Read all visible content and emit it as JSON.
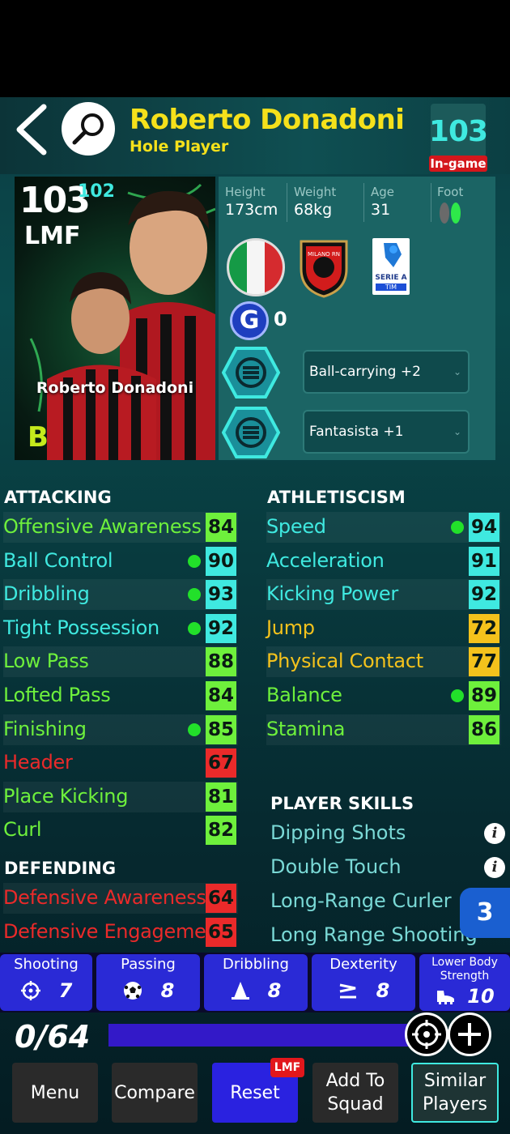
{
  "header": {
    "player_name": "Roberto Donadoni",
    "role": "Hole Player",
    "overall": "103",
    "overall_tag": "In-game"
  },
  "card": {
    "rating": "103",
    "sub_rating": "102",
    "position": "LMF",
    "name": "Roberto Donadoni",
    "grade": "B"
  },
  "info": {
    "height_label": "Height",
    "height": "173cm",
    "weight_label": "Weight",
    "weight": "68kg",
    "age_label": "Age",
    "age": "31",
    "foot_label": "Foot",
    "nationality_flag": "italy-flag",
    "club_badge_text": "MILANO RN",
    "league_text": "SERIE A",
    "league_sub": "TIM",
    "g_count": "0"
  },
  "booster_skills": [
    {
      "label": "Ball-carrying +2"
    },
    {
      "label": "Fantasista +1"
    }
  ],
  "attacking": {
    "title": "ATTACKING",
    "stats": [
      {
        "name": "Offensive Awareness",
        "value": "84",
        "dot": false,
        "color": "#6ef03c",
        "text": "#6ef03c"
      },
      {
        "name": "Ball Control",
        "value": "90",
        "dot": true,
        "color": "#3fe9e0",
        "text": "#3fe9e0"
      },
      {
        "name": "Dribbling",
        "value": "93",
        "dot": true,
        "color": "#3fe9e0",
        "text": "#3fe9e0"
      },
      {
        "name": "Tight Possession",
        "value": "92",
        "dot": true,
        "color": "#3fe9e0",
        "text": "#3fe9e0"
      },
      {
        "name": "Low Pass",
        "value": "88",
        "dot": false,
        "color": "#6ef03c",
        "text": "#6ef03c"
      },
      {
        "name": "Lofted Pass",
        "value": "84",
        "dot": false,
        "color": "#6ef03c",
        "text": "#6ef03c"
      },
      {
        "name": "Finishing",
        "value": "85",
        "dot": true,
        "color": "#6ef03c",
        "text": "#6ef03c"
      },
      {
        "name": "Header",
        "value": "67",
        "dot": false,
        "color": "#ea2a2a",
        "text": "#ea2a2a"
      },
      {
        "name": "Place Kicking",
        "value": "81",
        "dot": false,
        "color": "#6ef03c",
        "text": "#6ef03c"
      },
      {
        "name": "Curl",
        "value": "82",
        "dot": false,
        "color": "#6ef03c",
        "text": "#6ef03c"
      }
    ]
  },
  "defending": {
    "title": "DEFENDING",
    "stats": [
      {
        "name": "Defensive Awareness",
        "value": "64",
        "dot": false,
        "color": "#ea2a2a",
        "text": "#ea2a2a"
      },
      {
        "name": "Defensive Engagement",
        "value": "65",
        "dot": false,
        "color": "#ea2a2a",
        "text": "#ea2a2a"
      }
    ]
  },
  "athleticism": {
    "title": "ATHLETISCISM",
    "stats": [
      {
        "name": "Speed",
        "value": "94",
        "dot": true,
        "color": "#3fe9e0",
        "text": "#3fe9e0"
      },
      {
        "name": "Acceleration",
        "value": "91",
        "dot": false,
        "color": "#3fe9e0",
        "text": "#3fe9e0"
      },
      {
        "name": "Kicking Power",
        "value": "92",
        "dot": false,
        "color": "#3fe9e0",
        "text": "#3fe9e0"
      },
      {
        "name": "Jump",
        "value": "72",
        "dot": false,
        "color": "#f4c21c",
        "text": "#f4c21c"
      },
      {
        "name": "Physical Contact",
        "value": "77",
        "dot": false,
        "color": "#f4c21c",
        "text": "#f4c21c"
      },
      {
        "name": "Balance",
        "value": "89",
        "dot": true,
        "color": "#6ef03c",
        "text": "#6ef03c"
      },
      {
        "name": "Stamina",
        "value": "86",
        "dot": false,
        "color": "#6ef03c",
        "text": "#6ef03c"
      }
    ]
  },
  "player_skills": {
    "title": "PLAYER SKILLS",
    "items": [
      "Dipping Shots",
      "Double Touch",
      "Long-Range Curler",
      "Long Range Shooting"
    ],
    "count_badge": "3"
  },
  "categories": [
    {
      "label": "Shooting",
      "icon": "crosshair-icon",
      "value": "7"
    },
    {
      "label": "Passing",
      "icon": "ball-icon",
      "value": "8"
    },
    {
      "label": "Dribbling",
      "icon": "cone-icon",
      "value": "8"
    },
    {
      "label": "Dexterity",
      "icon": "dexterity-icon",
      "value": "8"
    },
    {
      "label": "Lower Body Strength",
      "icon": "boot-icon",
      "value": "10"
    }
  ],
  "progress": {
    "points": "0/64",
    "fill": 1.0
  },
  "bottom_buttons": [
    {
      "label": "Menu"
    },
    {
      "label": "Compare"
    },
    {
      "label": "Reset",
      "badge": "LMF"
    },
    {
      "label": "Add To Squad"
    },
    {
      "label": "Similar Players"
    }
  ],
  "colors": {
    "accent_yellow": "#f5e11b",
    "cyan": "#3fe9e0",
    "blue_btn": "#2a2ad6"
  }
}
